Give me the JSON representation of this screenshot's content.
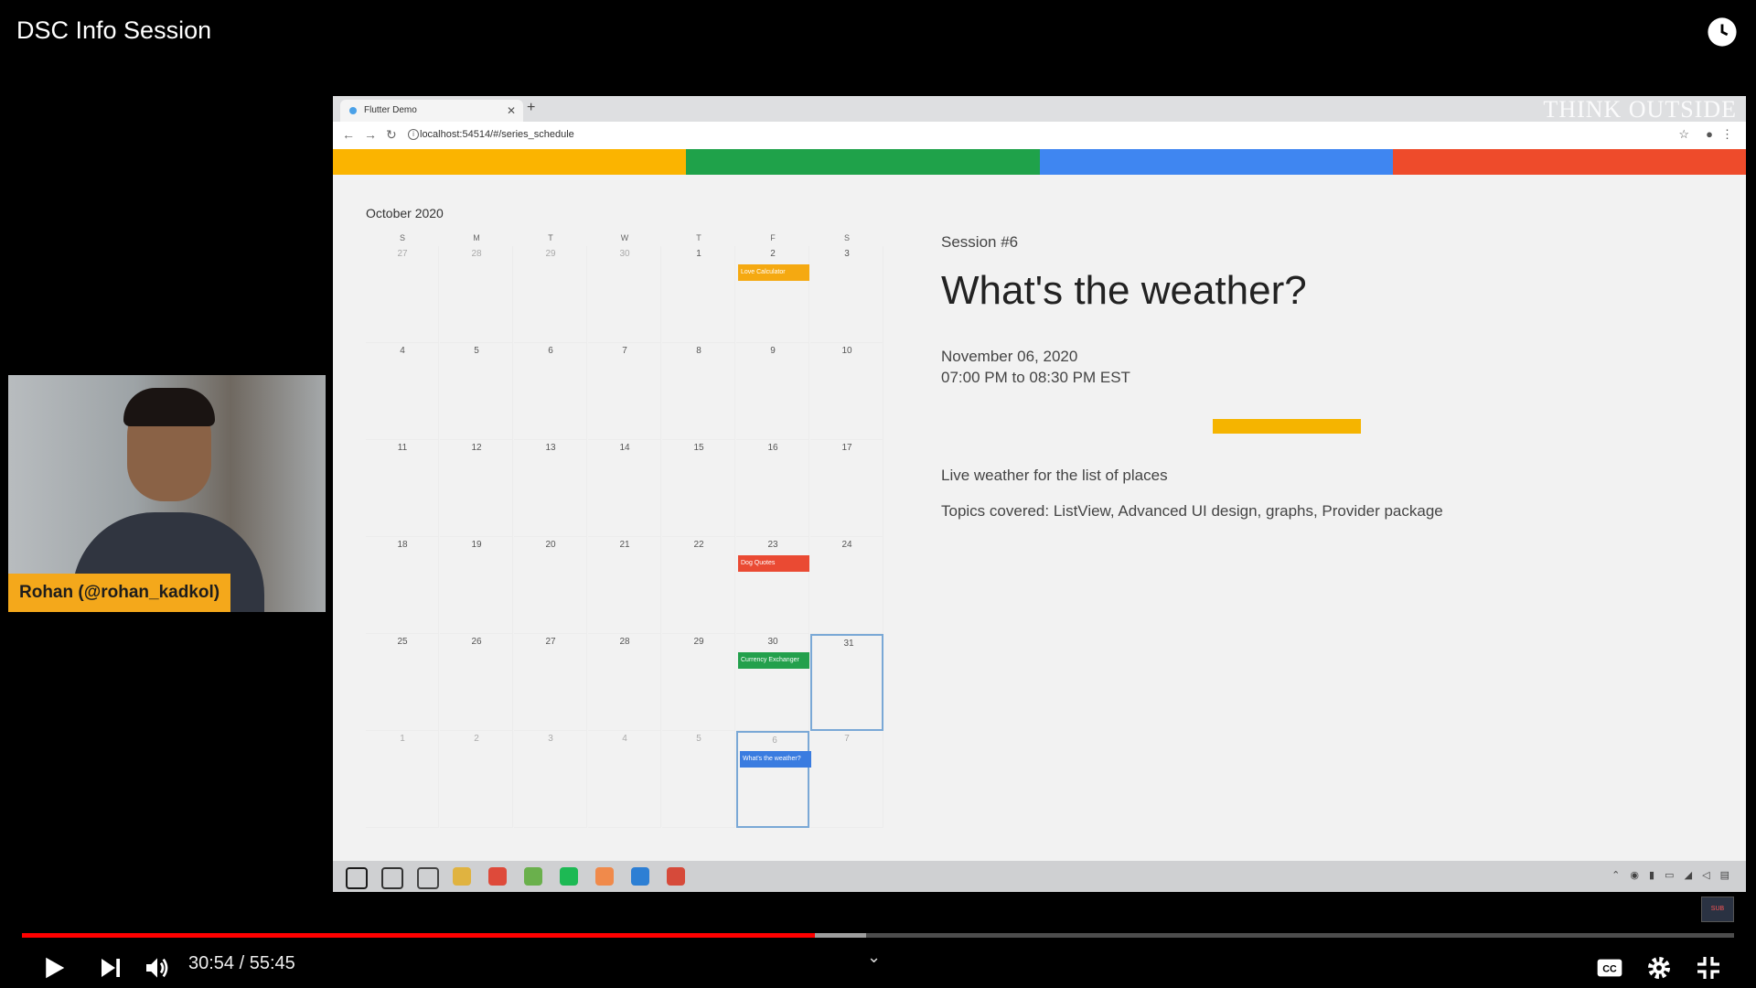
{
  "player": {
    "title": "DSC Info Session",
    "time_current": "30:54",
    "time_total": "55:45",
    "time_display": "30:54 / 55:45",
    "progress_played": 0.463,
    "progress_buffered": 0.493
  },
  "browser": {
    "tab_title": "Flutter Demo",
    "url": "localhost:54514/#/series_schedule",
    "watermark": "THINK OUTSIDE"
  },
  "stripes": [
    "#FBB400",
    "#1FA24A",
    "#3F86F1",
    "#EE4B2B"
  ],
  "calendar": {
    "month": "October 2020",
    "weekdays": [
      "S",
      "M",
      "T",
      "W",
      "T",
      "F",
      "S"
    ],
    "weeks": [
      [
        "27",
        "28",
        "29",
        "30",
        "1",
        "2",
        "3"
      ],
      [
        "4",
        "5",
        "6",
        "7",
        "8",
        "9",
        "10"
      ],
      [
        "11",
        "12",
        "13",
        "14",
        "15",
        "16",
        "17"
      ],
      [
        "18",
        "19",
        "20",
        "21",
        "22",
        "23",
        "24"
      ],
      [
        "25",
        "26",
        "27",
        "28",
        "29",
        "30",
        "31"
      ],
      [
        "1",
        "2",
        "3",
        "4",
        "5",
        "6",
        "7"
      ]
    ],
    "events": [
      {
        "label": "Love Calculator",
        "color": "#F5A911"
      },
      {
        "label": "Dog Quotes",
        "color": "#EA4A33"
      },
      {
        "label": "Currency Exchanger",
        "color": "#23A04C"
      },
      {
        "label": "What's the weather?",
        "color": "#3A7CE0"
      }
    ]
  },
  "session": {
    "number": "Session #6",
    "title": "What's the weather?",
    "date": "November 06, 2020",
    "time": "07:00 PM to 08:30 PM EST",
    "accent": "#F5B400",
    "description": "Live weather for the list of places",
    "topics": "Topics covered: ListView, Advanced UI design, graphs, Provider package"
  },
  "webcam": {
    "name_label": "Rohan (@rohan_kadkol)"
  },
  "taskbar_icons": [
    "windows-icon",
    "cortana-icon",
    "task-view-icon",
    "file-explorer-icon",
    "chrome-icon",
    "android-studio-icon",
    "spotify-icon",
    "snip-icon",
    "vscode-icon",
    "chrome-alt-icon"
  ]
}
